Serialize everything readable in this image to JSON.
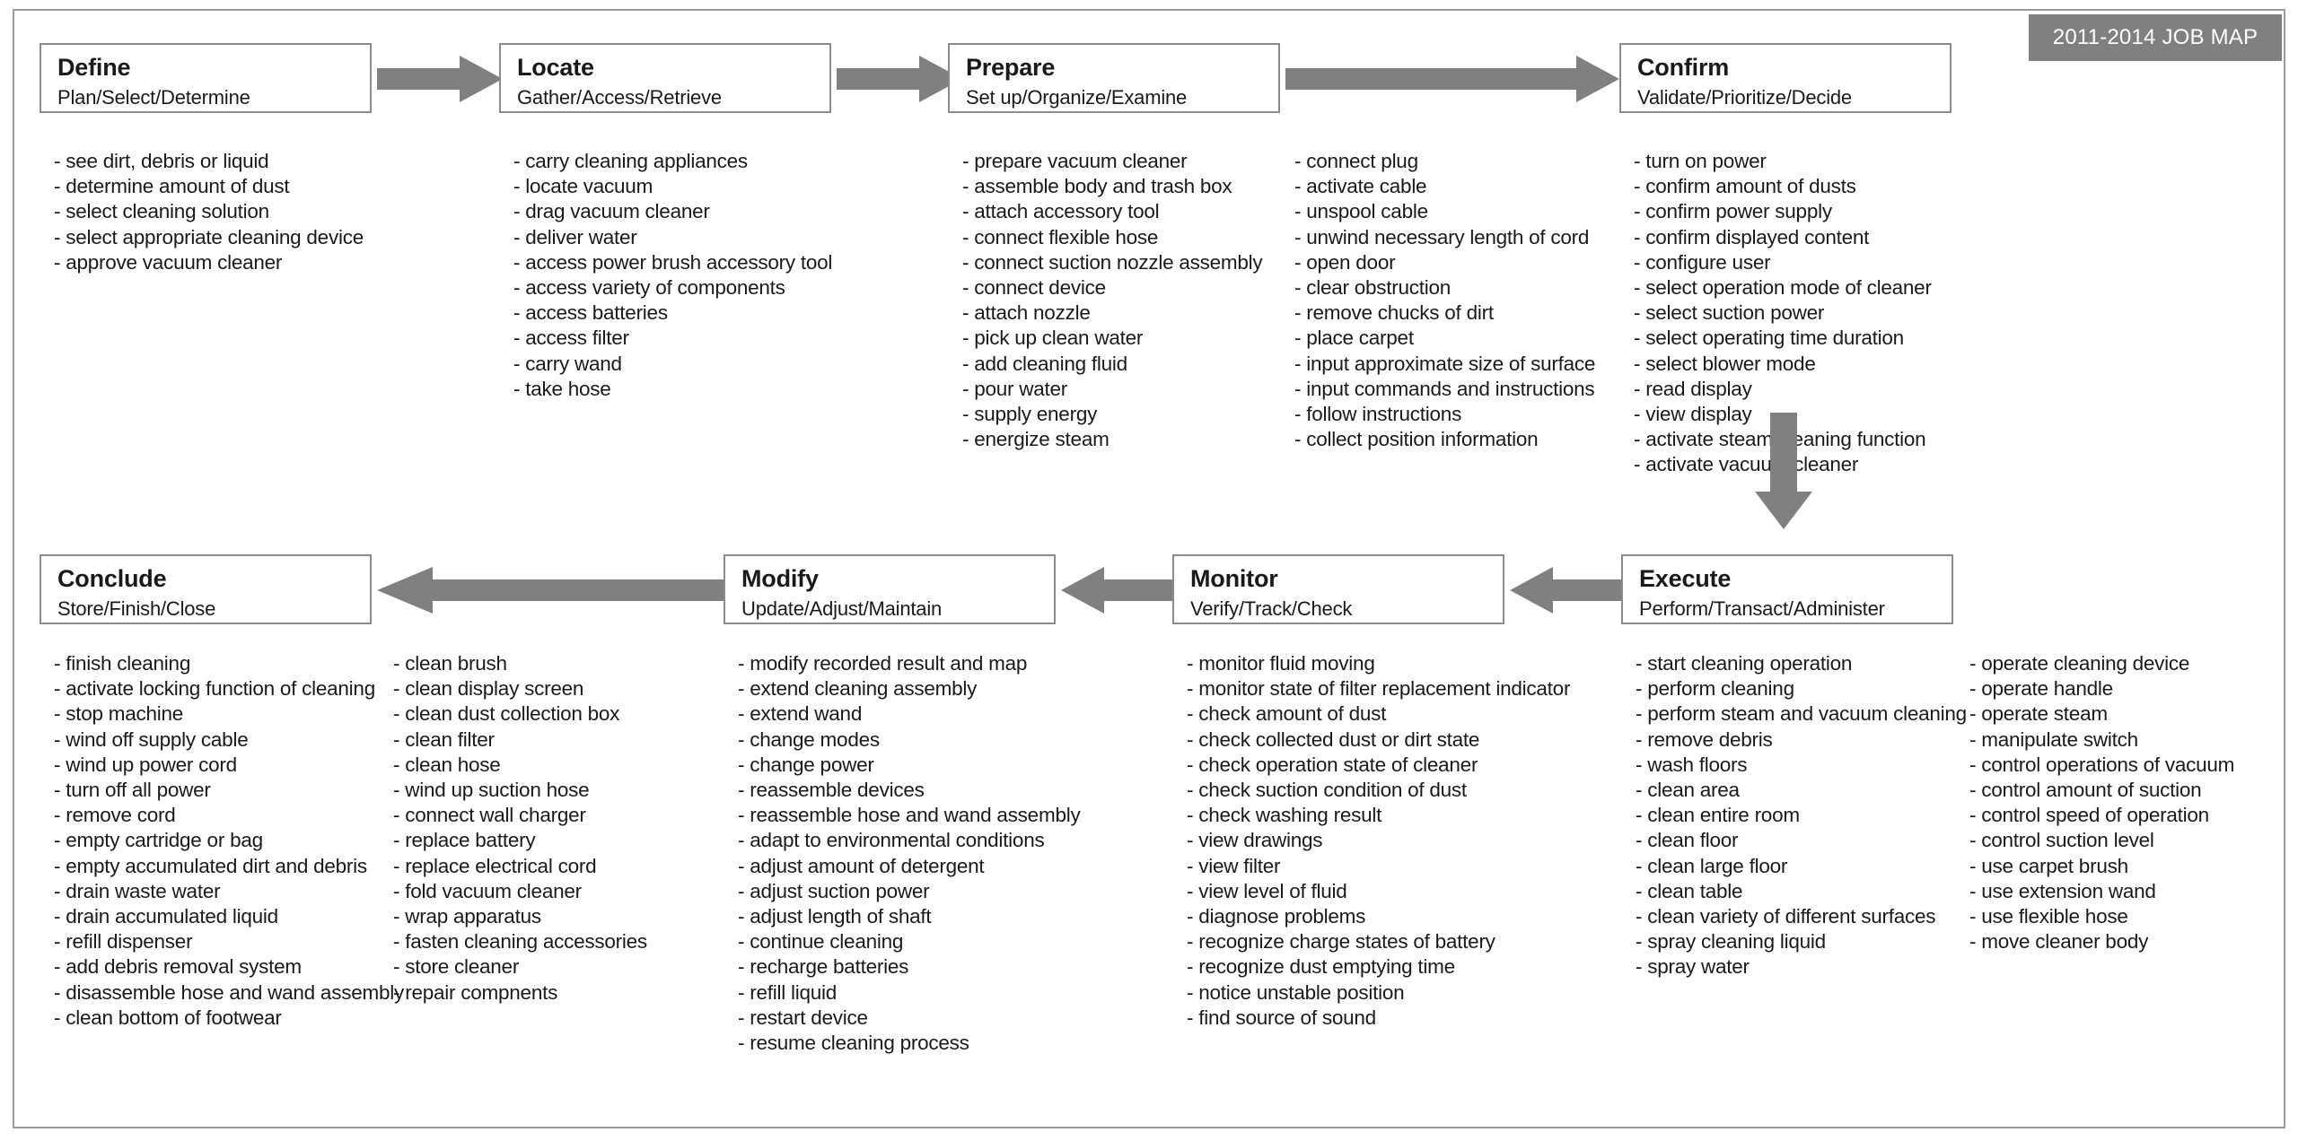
{
  "badge": {
    "label": "2011-2014 JOB MAP"
  },
  "stages": [
    {
      "id": "define",
      "title": "Define",
      "subtitle": "Plan/Select/Determine",
      "columns": [
        [
          "- see dirt, debris or liquid",
          "- determine amount of dust",
          "- select cleaning solution",
          "- select appropriate cleaning device",
          "- approve vacuum cleaner"
        ]
      ]
    },
    {
      "id": "locate",
      "title": "Locate",
      "subtitle": "Gather/Access/Retrieve",
      "columns": [
        [
          "- carry cleaning appliances",
          "- locate vacuum",
          "- drag vacuum cleaner",
          "- deliver water",
          "- access power brush accessory tool",
          "- access variety of components",
          "- access batteries",
          "- access filter",
          "- carry wand",
          "- take hose"
        ]
      ]
    },
    {
      "id": "prepare",
      "title": "Prepare",
      "subtitle": "Set up/Organize/Examine",
      "columns": [
        [
          "- prepare vacuum cleaner",
          "- assemble body and trash box",
          "- attach accessory tool",
          "- connect flexible hose",
          "- connect suction nozzle assembly",
          "- connect device",
          "- attach nozzle",
          "- pick up clean water",
          "- add cleaning fluid",
          "- pour water",
          "- supply energy",
          "- energize steam"
        ],
        [
          "- connect plug",
          "- activate cable",
          "- unspool cable",
          "- unwind necessary length of cord",
          "- open door",
          "- clear obstruction",
          "- remove chucks of dirt",
          "- place carpet",
          "- input approximate size of surface",
          "- input commands and instructions",
          "- follow instructions",
          "- collect position information"
        ]
      ]
    },
    {
      "id": "confirm",
      "title": "Confirm",
      "subtitle": "Validate/Prioritize/Decide",
      "columns": [
        [
          "- turn on power",
          "- confirm amount of dusts",
          "- confirm power supply",
          "- confirm displayed content",
          "- configure user",
          "- select operation mode of cleaner",
          "- select suction power",
          "- select operating time duration",
          "- select blower mode",
          "- read display",
          "- view display",
          "- activate steam cleaning function",
          "- activate vacuum cleaner"
        ]
      ]
    },
    {
      "id": "conclude",
      "title": "Conclude",
      "subtitle": "Store/Finish/Close",
      "columns": [
        [
          "- finish cleaning",
          "- activate locking function of cleaning",
          "- stop machine",
          "- wind off supply cable",
          "- wind up power cord",
          "- turn off all power",
          "- remove cord",
          "- empty cartridge or bag",
          "- empty accumulated dirt and debris",
          "- drain waste water",
          "- drain accumulated liquid",
          "- refill dispenser",
          "- add debris removal system",
          "- disassemble hose and wand assembly",
          "- clean bottom of footwear"
        ],
        [
          "- clean brush",
          "- clean display screen",
          "- clean dust collection box",
          "- clean filter",
          "- clean hose",
          "- wind up suction hose",
          "- connect wall charger",
          "- replace battery",
          "- replace electrical cord",
          "- fold vacuum cleaner",
          "- wrap apparatus",
          "- fasten cleaning accessories",
          "- store cleaner",
          "- repair compnents"
        ]
      ]
    },
    {
      "id": "modify",
      "title": "Modify",
      "subtitle": "Update/Adjust/Maintain",
      "columns": [
        [
          "- modify recorded result and map",
          "- extend cleaning assembly",
          "- extend wand",
          "- change modes",
          "- change power",
          "- reassemble devices",
          "- reassemble hose and wand assembly",
          "- adapt to environmental conditions",
          "- adjust amount of detergent",
          "- adjust suction power",
          "- adjust length of shaft",
          "- continue cleaning",
          "- recharge batteries",
          "- refill liquid",
          "- restart device",
          "- resume cleaning process"
        ]
      ]
    },
    {
      "id": "monitor",
      "title": "Monitor",
      "subtitle": "Verify/Track/Check",
      "columns": [
        [
          "- monitor fluid moving",
          "- monitor state of filter replacement indicator",
          "- check amount of dust",
          "- check collected dust or dirt state",
          "- check operation state of cleaner",
          "- check suction condition of dust",
          "- check washing result",
          "- view drawings",
          "- view filter",
          "- view level of fluid",
          "- diagnose problems",
          "- recognize charge states of battery",
          "- recognize dust emptying time",
          "- notice unstable position",
          "- find source of sound"
        ]
      ]
    },
    {
      "id": "execute",
      "title": "Execute",
      "subtitle": "Perform/Transact/Administer",
      "columns": [
        [
          "- start cleaning operation",
          "- perform cleaning",
          "- perform steam and vacuum cleaning",
          "- remove debris",
          "- wash floors",
          "- clean area",
          "- clean entire room",
          "- clean floor",
          "- clean large floor",
          "- clean table",
          "- clean variety of different surfaces",
          "- spray cleaning liquid",
          "- spray water"
        ],
        [
          "- operate cleaning device",
          "- operate handle",
          "- operate steam",
          "- manipulate switch",
          "- control operations of vacuum",
          "- control amount of suction",
          "- control speed of operation",
          "- control suction level",
          "- use carpet brush",
          "- use extension wand",
          "- use flexible hose",
          "- move cleaner body"
        ]
      ]
    }
  ],
  "arrows": [
    {
      "id": "define-to-locate",
      "direction": "right"
    },
    {
      "id": "locate-to-prepare",
      "direction": "right"
    },
    {
      "id": "prepare-to-confirm",
      "direction": "right"
    },
    {
      "id": "confirm-to-execute",
      "direction": "down"
    },
    {
      "id": "execute-to-monitor",
      "direction": "left"
    },
    {
      "id": "monitor-to-modify",
      "direction": "left"
    },
    {
      "id": "modify-to-conclude",
      "direction": "left"
    }
  ],
  "colors": {
    "arrow": "#808080",
    "badge_bg": "#808080",
    "box_border": "#8c8c8c",
    "frame": "#9a9a9a",
    "text": "#1a1a1a"
  }
}
